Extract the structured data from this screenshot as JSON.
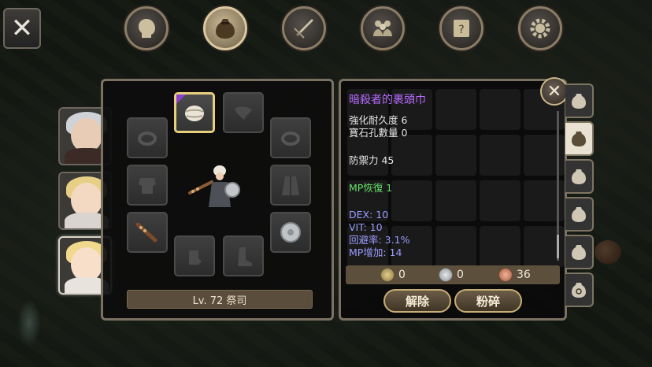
{
  "close_label": "✕",
  "tabs": [
    {
      "icon": "head-silhouette-icon",
      "active": false
    },
    {
      "icon": "bag-icon",
      "active": true
    },
    {
      "icon": "sword-skill-icon",
      "active": false
    },
    {
      "icon": "party-icon",
      "active": false
    },
    {
      "icon": "quest-scroll-icon",
      "active": false
    },
    {
      "icon": "gear-icon",
      "active": false
    }
  ],
  "characters": [
    {
      "hair": "#cfd3d8",
      "face": "#e8ccb6",
      "body": "#3b2a25",
      "active": false
    },
    {
      "hair": "#e7cf86",
      "face": "#f3d9c2",
      "body": "#d9d4cf",
      "active": false
    },
    {
      "hair": "#f0d98c",
      "face": "#f7dfca",
      "body": "#e8e3dc",
      "active": true
    }
  ],
  "equipment": {
    "level_label": "Lv. 72 祭司",
    "slots": [
      {
        "name": "helmet-slot",
        "icon": "turban-icon",
        "filled": true,
        "selected": true
      },
      {
        "name": "cape-slot",
        "icon": "cape-icon",
        "filled": false
      },
      {
        "name": "ring-left-slot",
        "icon": "ring-icon",
        "filled": false
      },
      {
        "name": "ring-right-slot",
        "icon": "ring-icon",
        "filled": false
      },
      {
        "name": "armor-slot",
        "icon": "armor-icon",
        "filled": false
      },
      {
        "name": "robe-slot",
        "icon": "robe-icon",
        "filled": false
      },
      {
        "name": "weapon-slot",
        "icon": "club-icon",
        "filled": true
      },
      {
        "name": "shield-slot",
        "icon": "shield-icon",
        "filled": true
      },
      {
        "name": "gloves-slot",
        "icon": "gloves-icon",
        "filled": false
      },
      {
        "name": "boots-slot",
        "icon": "boots-icon",
        "filled": false
      }
    ]
  },
  "item": {
    "name": "暗殺者的裹頭巾",
    "stats": [
      {
        "text": "強化耐久度 6",
        "style": "white"
      },
      {
        "text": "寶石孔數量 0",
        "style": "white"
      },
      {
        "text": "防禦力 45",
        "style": "white"
      },
      {
        "text": "MP恢復 1",
        "style": "green"
      },
      {
        "text": "DEX: 10",
        "style": "blue"
      },
      {
        "text": "VIT: 10",
        "style": "blue"
      },
      {
        "text": "回避率: 3.1%",
        "style": "blue"
      },
      {
        "text": "MP增加: 14",
        "style": "blue"
      }
    ],
    "close_label": "✕"
  },
  "currency": {
    "gold": "0",
    "silver": "0",
    "copper": "36"
  },
  "actions": {
    "unequip_label": "解除",
    "smash_label": "粉碎"
  },
  "side_tabs": [
    {
      "icon": "bag-icon",
      "active": false
    },
    {
      "icon": "bag-icon",
      "active": true
    },
    {
      "icon": "bag-icon",
      "active": false
    },
    {
      "icon": "bag-icon",
      "active": false
    },
    {
      "icon": "bag-icon",
      "active": false
    },
    {
      "icon": "bag-search-icon",
      "active": false
    }
  ],
  "colors": {
    "item_name": "#b66bff",
    "stat_green": "#66e06a",
    "stat_blue": "#9c9cff",
    "frame_gold": "#c7ad77"
  }
}
